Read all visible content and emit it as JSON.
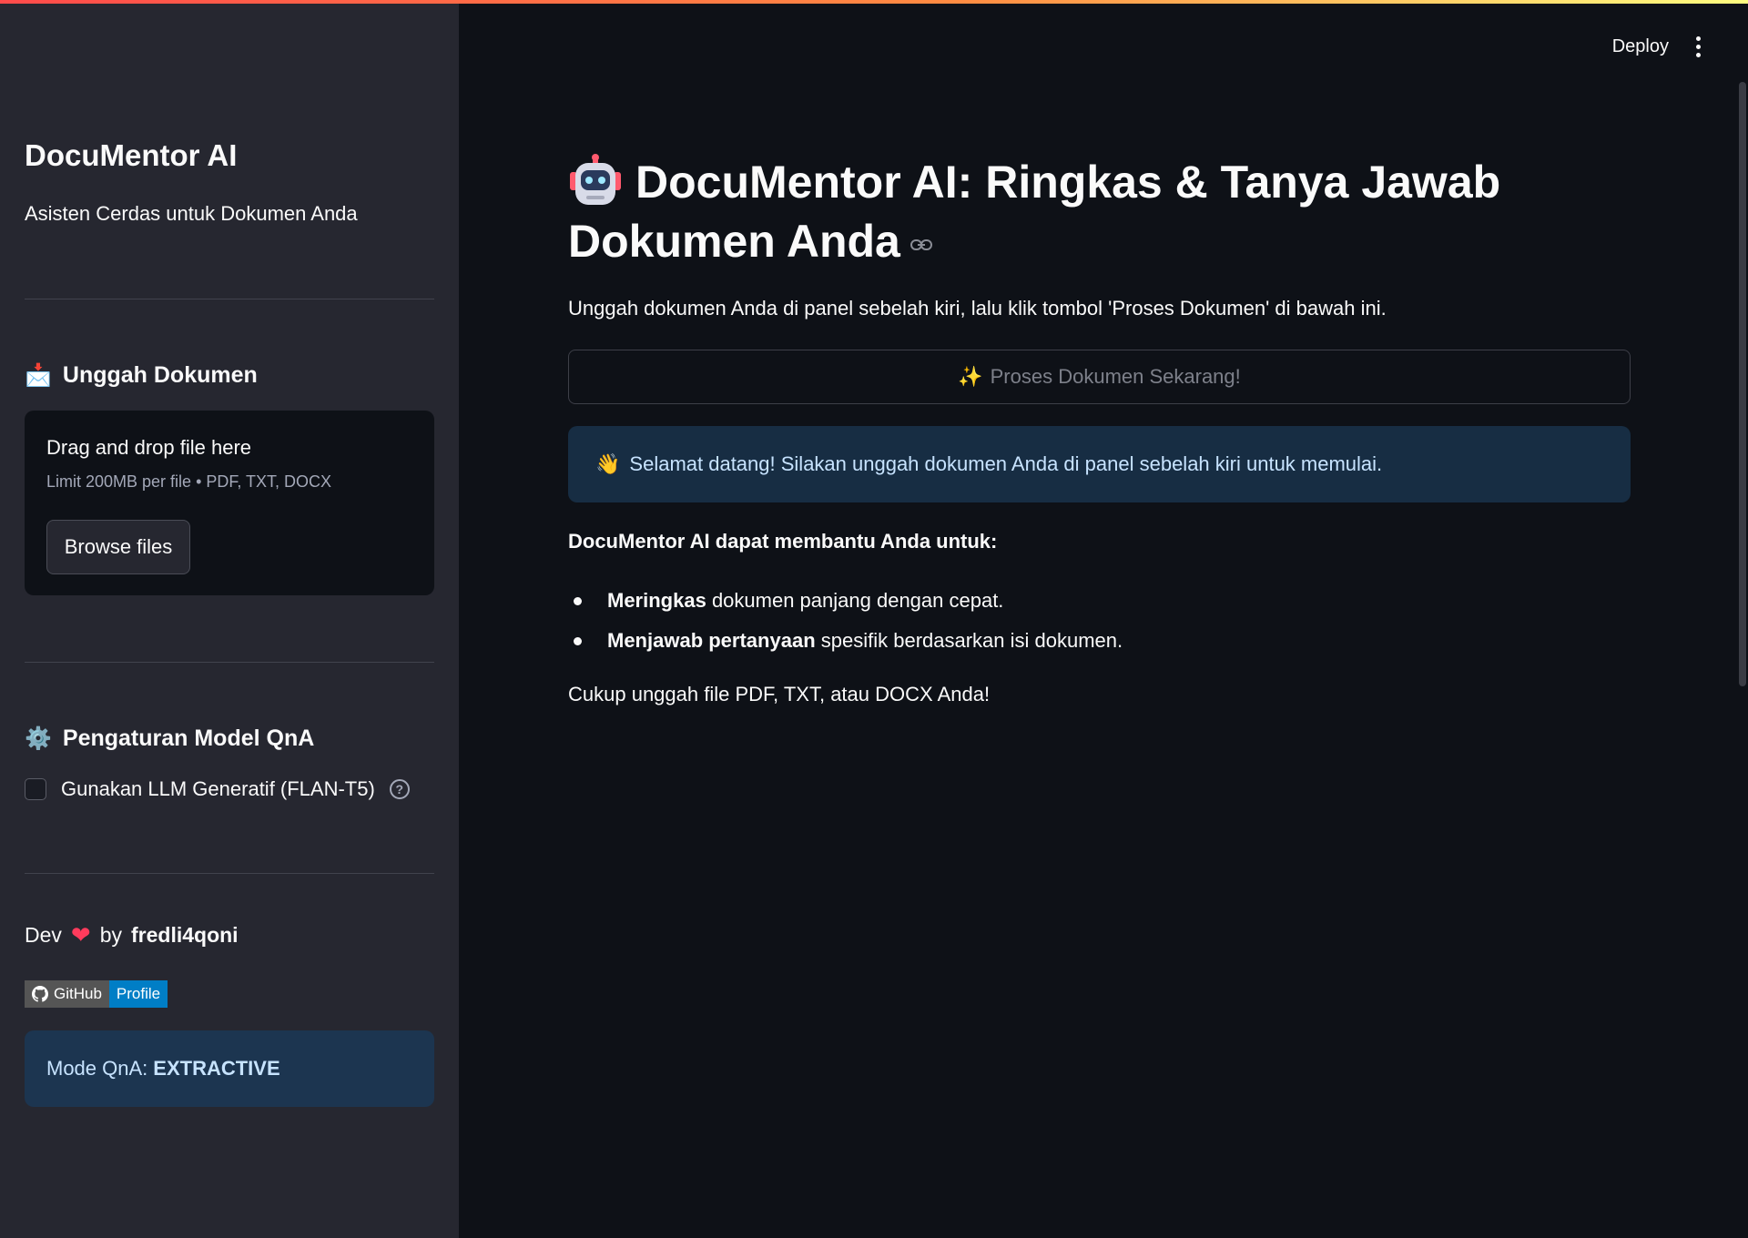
{
  "header": {
    "deploy_label": "Deploy"
  },
  "sidebar": {
    "title": "DocuMentor AI",
    "subtitle": "Asisten Cerdas untuk Dokumen Anda",
    "upload_section": {
      "emoji": "📩",
      "heading": "Unggah Dokumen",
      "drag_text": "Drag and drop file here",
      "limit_text": "Limit 200MB per file • PDF, TXT, DOCX",
      "browse_label": "Browse files"
    },
    "settings_section": {
      "emoji": "⚙️",
      "heading": "Pengaturan Model QnA",
      "checkbox_label": "Gunakan LLM Generatif (FLAN-T5)",
      "help_glyph": "?"
    },
    "dev": {
      "prefix": "Dev",
      "heart": "❤",
      "by": "by",
      "author": "fredli4qoni"
    },
    "badge": {
      "left": "GitHub",
      "right": "Profile",
      "left_color": "#555555",
      "right_color": "#007ec6"
    },
    "mode": {
      "label": "Mode QnA:",
      "value": "EXTRACTIVE"
    }
  },
  "main": {
    "title": "DocuMentor AI: Ringkas & Tanya Jawab Dokumen Anda",
    "intro": "Unggah dokumen Anda di panel sebelah kiri, lalu klik tombol 'Proses Dokumen' di bawah ini.",
    "process_button": {
      "emoji": "✨",
      "label": "Proses Dokumen Sekarang!"
    },
    "info": {
      "emoji": "👋",
      "text": "Selamat datang! Silakan unggah dokumen Anda di panel sebelah kiri untuk memulai."
    },
    "help_heading": "DocuMentor AI dapat membantu Anda untuk:",
    "bullets": [
      {
        "bold": "Meringkas",
        "rest": " dokumen panjang dengan cepat."
      },
      {
        "bold": "Menjawab pertanyaan",
        "rest": " spesifik berdasarkan isi dokumen."
      }
    ],
    "footer": "Cukup unggah file PDF, TXT, atau DOCX Anda!"
  }
}
